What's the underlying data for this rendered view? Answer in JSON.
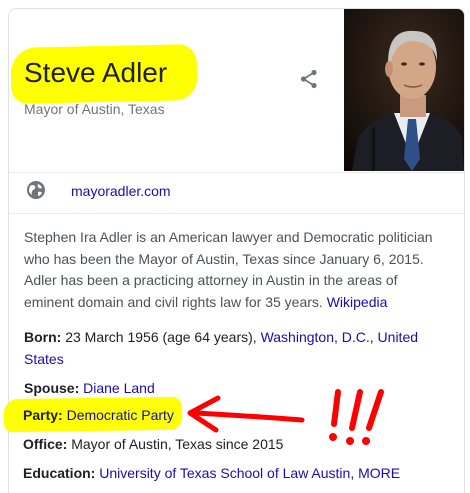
{
  "entity": {
    "name": "Steve Adler",
    "subtitle": "Mayor of Austin, Texas"
  },
  "website": {
    "label": "mayoradler.com"
  },
  "description": {
    "text": "Stephen Ira Adler is an American lawyer and Democratic politician who has been the Mayor of Austin, Texas since January 6, 2015. Adler has been a practicing attorney in Austin in the areas of eminent domain and civil rights law for 35 years.",
    "source": "Wikipedia"
  },
  "facts": {
    "born": {
      "label": "Born:",
      "text": "23 March 1956 (age 64 years),",
      "place_city": "Washington, D.C.",
      "place_sep": ",",
      "place_state": "United States"
    },
    "spouse": {
      "label": "Spouse:",
      "value": "Diane Land"
    },
    "party": {
      "label": "Party:",
      "value": "Democratic Party"
    },
    "office": {
      "label": "Office:",
      "value": "Mayor of Austin, Texas since 2015"
    },
    "education": {
      "label": "Education:",
      "value": "University of Texas School of Law Austin",
      "sep": ",",
      "more": "MORE"
    }
  },
  "icons": {
    "share": "share-icon",
    "globe": "globe-icon"
  },
  "colors": {
    "highlight": "#ffff00",
    "annotation": "#ff0000",
    "link": "#1a0dab"
  }
}
